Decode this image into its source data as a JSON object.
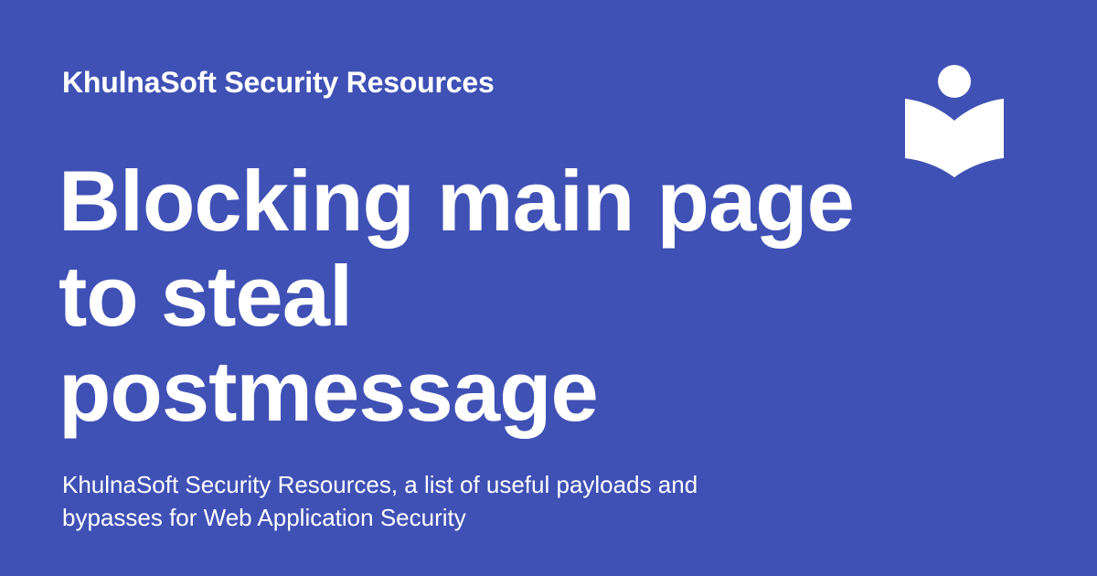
{
  "card": {
    "site_name": "KhulnaSoft Security Resources",
    "title": "Blocking main page to steal postmessage",
    "description": "KhulnaSoft Security Resources, a list of useful payloads and bypasses for Web Application Security",
    "logo_icon": "book-reader-icon",
    "colors": {
      "background": "#3f51b5",
      "foreground": "#ffffff"
    }
  }
}
